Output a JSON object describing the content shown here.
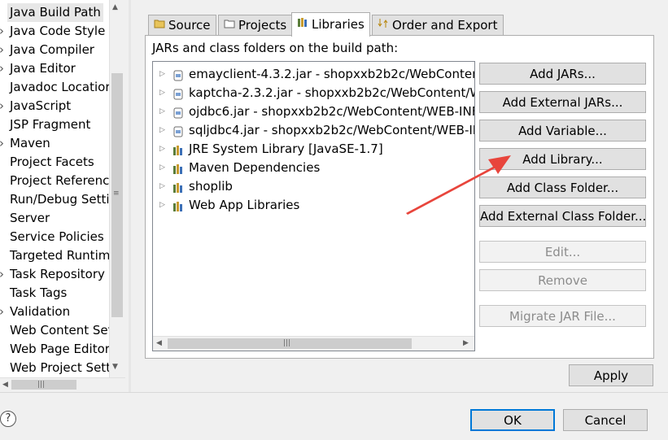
{
  "categories": {
    "items": [
      {
        "label": "Java Build Path",
        "has_arrow": false,
        "selected": true
      },
      {
        "label": "Java Code Style",
        "has_arrow": true
      },
      {
        "label": "Java Compiler",
        "has_arrow": true
      },
      {
        "label": "Java Editor",
        "has_arrow": true
      },
      {
        "label": "Javadoc Locatior",
        "has_arrow": false
      },
      {
        "label": "JavaScript",
        "has_arrow": true
      },
      {
        "label": "JSP Fragment",
        "has_arrow": false
      },
      {
        "label": "Maven",
        "has_arrow": true
      },
      {
        "label": "Project Facets",
        "has_arrow": false
      },
      {
        "label": "Project Referenc",
        "has_arrow": false
      },
      {
        "label": "Run/Debug Setti",
        "has_arrow": false
      },
      {
        "label": "Server",
        "has_arrow": false
      },
      {
        "label": "Service Policies",
        "has_arrow": false
      },
      {
        "label": "Targeted Runtim",
        "has_arrow": false
      },
      {
        "label": "Task Repository",
        "has_arrow": true
      },
      {
        "label": "Task Tags",
        "has_arrow": false
      },
      {
        "label": "Validation",
        "has_arrow": true
      },
      {
        "label": "Web Content Set",
        "has_arrow": false
      },
      {
        "label": "Web Page Editor",
        "has_arrow": false
      },
      {
        "label": "Web Project Sett",
        "has_arrow": false
      }
    ]
  },
  "tabs": [
    {
      "label": "Source",
      "icon": "source-folder-icon"
    },
    {
      "label": "Projects",
      "icon": "projects-icon"
    },
    {
      "label": "Libraries",
      "icon": "libraries-icon",
      "active": true
    },
    {
      "label": "Order and Export",
      "icon": "order-export-icon"
    }
  ],
  "content": {
    "build_path_label": "JARs and class folders on the build path:"
  },
  "tree": [
    {
      "label": "emayclient-4.3.2.jar - shopxxb2b2c/WebContent",
      "icon": "jar-icon"
    },
    {
      "label": "kaptcha-2.3.2.jar - shopxxb2b2c/WebContent/W",
      "icon": "jar-icon"
    },
    {
      "label": "ojdbc6.jar - shopxxb2b2c/WebContent/WEB-INF",
      "icon": "jar-icon"
    },
    {
      "label": "sqljdbc4.jar - shopxxb2b2c/WebContent/WEB-IN",
      "icon": "jar-icon"
    },
    {
      "label": "JRE System Library [JavaSE-1.7]",
      "icon": "library-icon"
    },
    {
      "label": "Maven Dependencies",
      "icon": "library-icon"
    },
    {
      "label": "shoplib",
      "icon": "library-icon"
    },
    {
      "label": "Web App Libraries",
      "icon": "library-icon"
    }
  ],
  "buttons": {
    "add_jars": "Add JARs...",
    "add_external_jars": "Add External JARs...",
    "add_variable": "Add Variable...",
    "add_library": "Add Library...",
    "add_class_folder": "Add Class Folder...",
    "add_external_class_folder": "Add External Class Folder...",
    "edit": "Edit...",
    "remove": "Remove",
    "migrate_jar": "Migrate JAR File..."
  },
  "footer": {
    "apply": "Apply",
    "ok": "OK",
    "cancel": "Cancel",
    "help": "?"
  },
  "colors": {
    "annotation_arrow": "#e8453c",
    "focus_accent": "#0078d7"
  }
}
